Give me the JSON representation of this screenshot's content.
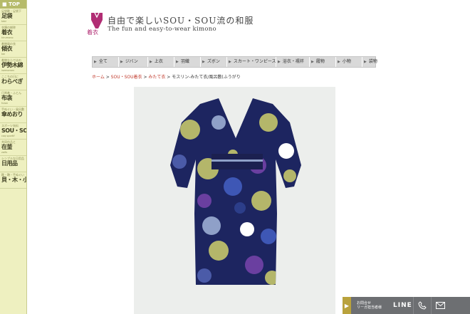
{
  "sidebar": {
    "top_label": "TOP",
    "items": [
      {
        "sub": "足袋靴・足袋下",
        "main": "足袋",
        "roman": "tabi"
      },
      {
        "sub": "衣類の総称",
        "main": "着衣",
        "roman": "kirumono"
      },
      {
        "sub": "着物風の衣",
        "main": "傾衣",
        "roman": "kei"
      },
      {
        "sub": "着物ならではの",
        "main": "伊勢木綿",
        "roman": "isemomen"
      },
      {
        "sub": "ここちの日に",
        "main": "わらべぎ",
        "roman": ""
      },
      {
        "sub": "日常着・ふとん",
        "main": "布衾",
        "roman": "futon"
      },
      {
        "sub": "手ぬぐい・風呂敷",
        "main": "傘めおり",
        "roman": ""
      },
      {
        "sub": "スポーツ衣料",
        "main": "SOU・SOU",
        "roman": "coq sportif"
      },
      {
        "sub": "共同作品と",
        "main": "在釜",
        "roman": "zaifu"
      },
      {
        "sub": "シンプルな日用品",
        "main": "日用品",
        "roman": ""
      },
      {
        "sub": "靴・鞄・手ぬぐい",
        "main": "貝・木・小物",
        "roman": ""
      }
    ]
  },
  "header": {
    "logo_label": "着衣",
    "title": "自由で楽しいSOU・SOU流の和服",
    "subtitle": "The fun and easy-to-wear kimono"
  },
  "nav": {
    "categories": [
      "全て",
      "ジバン",
      "上衣",
      "羽織",
      "ズボン",
      "スカート・ワンピース",
      "浴衣・襦袢",
      "履物",
      "小物",
      "袋物"
    ]
  },
  "breadcrumb": {
    "home": "ホーム",
    "sep": " > ",
    "level1": "SOU・SOU着衣",
    "level2": "みたて衣",
    "current": "モスリン-みたて衣/風呂敷(ふうがり"
  },
  "floatbar": {
    "contact_line1": "お問合せ",
    "contact_line2": "リーガ担当者様",
    "line": "LINE",
    "phone_icon": "phone-icon",
    "mail_icon": "mail-icon"
  },
  "colors": {
    "sidebar_bg": "#eef0c0",
    "brand_magenta": "#b12d74",
    "floatbar_bg": "#6d6f72",
    "kimono_navy": "#1d2560",
    "kimono_olive": "#b4b66a"
  }
}
